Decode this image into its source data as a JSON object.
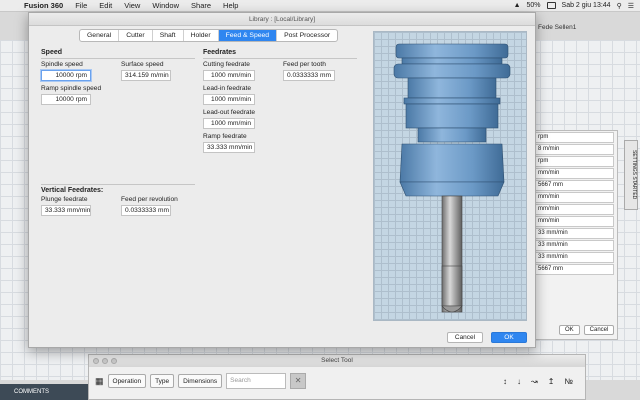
{
  "menubar": {
    "app_name": "Fusion 360",
    "items": [
      "File",
      "Edit",
      "View",
      "Window",
      "Share",
      "Help"
    ],
    "battery": "50%",
    "clock": "Sab 2 giu  13:44"
  },
  "app": {
    "user": "Fede Sellen1",
    "comments_label": "COMMENTS",
    "side_tab": "SETTINGS STARTED",
    "right_panel_rows": [
      "rpm",
      "8 m/min",
      "rpm",
      "mm/min",
      "5667 mm",
      "mm/min",
      "mm/min",
      "mm/min",
      "33 mm/min",
      "33 mm/min",
      "33 mm/min",
      "5667 mm"
    ],
    "right_panel_ok": "OK",
    "right_panel_cancel": "Cancel"
  },
  "dialog": {
    "title": "Library : [Local/Library]",
    "tabs": [
      "General",
      "Cutter",
      "Shaft",
      "Holder",
      "Feed & Speed",
      "Post Processor"
    ],
    "active_tab": "Feed & Speed",
    "speed": {
      "title": "Speed",
      "spindle_speed_label": "Spindle speed",
      "spindle_speed_value": "10000 rpm",
      "surface_speed_label": "Surface speed",
      "surface_speed_value": "314.159 m/min",
      "ramp_spindle_speed_label": "Ramp spindle speed",
      "ramp_spindle_speed_value": "10000 rpm"
    },
    "feedrates": {
      "title": "Feedrates",
      "cutting_feedrate_label": "Cutting feedrate",
      "cutting_feedrate_value": "1000 mm/min",
      "feed_per_tooth_label": "Feed per tooth",
      "feed_per_tooth_value": "0.0333333 mm",
      "leadin_feedrate_label": "Lead-in feedrate",
      "leadin_feedrate_value": "1000 mm/min",
      "leadout_feedrate_label": "Lead-out feedrate",
      "leadout_feedrate_value": "1000 mm/min",
      "ramp_feedrate_label": "Ramp feedrate",
      "ramp_feedrate_value": "33.333 mm/min"
    },
    "vertical": {
      "title": "Vertical Feedrates:",
      "plunge_feedrate_label": "Plunge feedrate",
      "plunge_feedrate_value": "33.333 mm/min",
      "feed_per_revolution_label": "Feed per revolution",
      "feed_per_revolution_value": "0.0333333 mm"
    },
    "cancel_label": "Cancel",
    "ok_label": "OK"
  },
  "select_tool": {
    "title": "Select Tool",
    "operation_label": "Operation",
    "type_label": "Type",
    "dimensions_label": "Dimensions",
    "search_placeholder": "Search"
  },
  "colors": {
    "accent": "#2f86f0",
    "holder": "#6f9fc9",
    "shaft": "#a8a8a8"
  }
}
